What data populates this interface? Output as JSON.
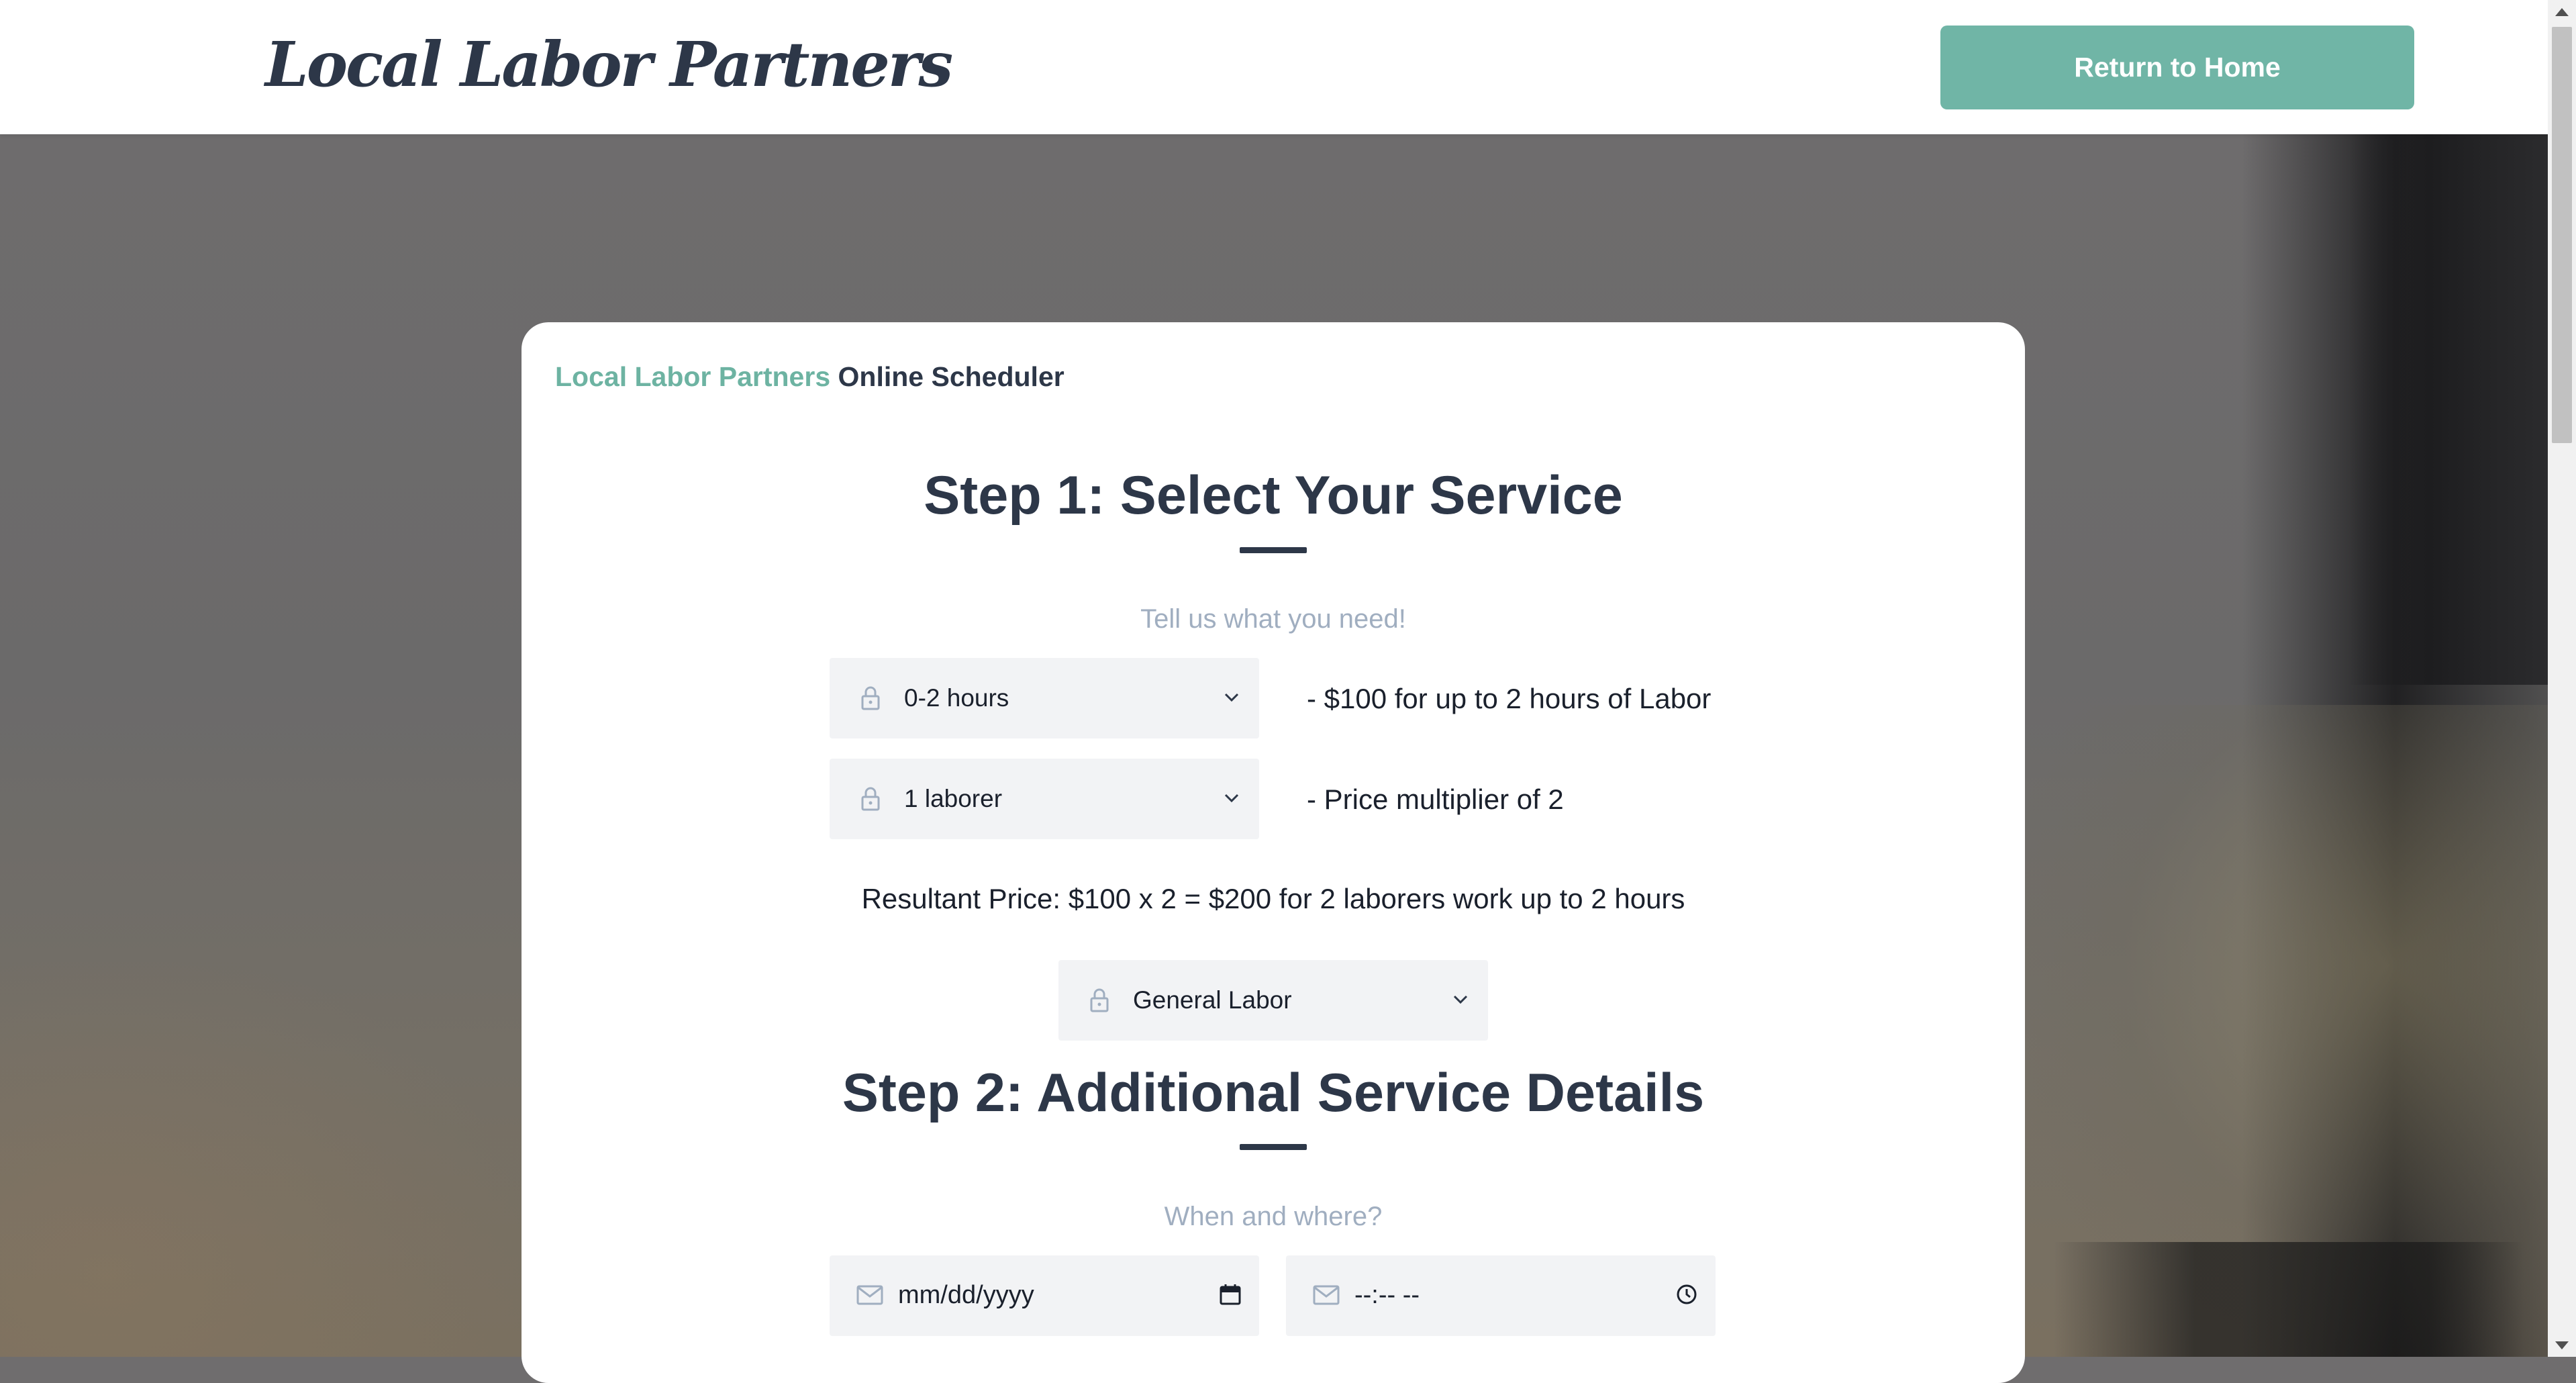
{
  "header": {
    "logo": "Local Labor Partners",
    "home_button": "Return to Home"
  },
  "card": {
    "brand_accent": "Local Labor Partners",
    "brand_rest": " Online Scheduler",
    "step1": {
      "title": "Step 1: Select Your Service",
      "subtitle": "Tell us what you need!",
      "hours_select": "0-2 hours",
      "hours_desc": "- $100 for up to 2 hours of Labor",
      "laborer_select": "1 laborer",
      "laborer_desc": "- Price multiplier of 2",
      "result": "Resultant Price: $100 x 2 = $200 for 2 laborers work up to 2 hours",
      "service_select": "General Labor"
    },
    "step2": {
      "title": "Step 2: Additional Service Details",
      "subtitle": "When and where?",
      "date_placeholder": "mm/dd/yyyy",
      "time_placeholder": "--:-- --"
    }
  },
  "colors": {
    "accent": "#70b5a6",
    "text_dark": "#2d3748",
    "muted": "#a0aec0"
  },
  "icons": {
    "select_icon": "lock-icon",
    "select_dropdown": "chevron-down-icon",
    "field_icon": "mail-icon",
    "date_icon": "calendar-icon",
    "time_icon": "clock-icon"
  }
}
